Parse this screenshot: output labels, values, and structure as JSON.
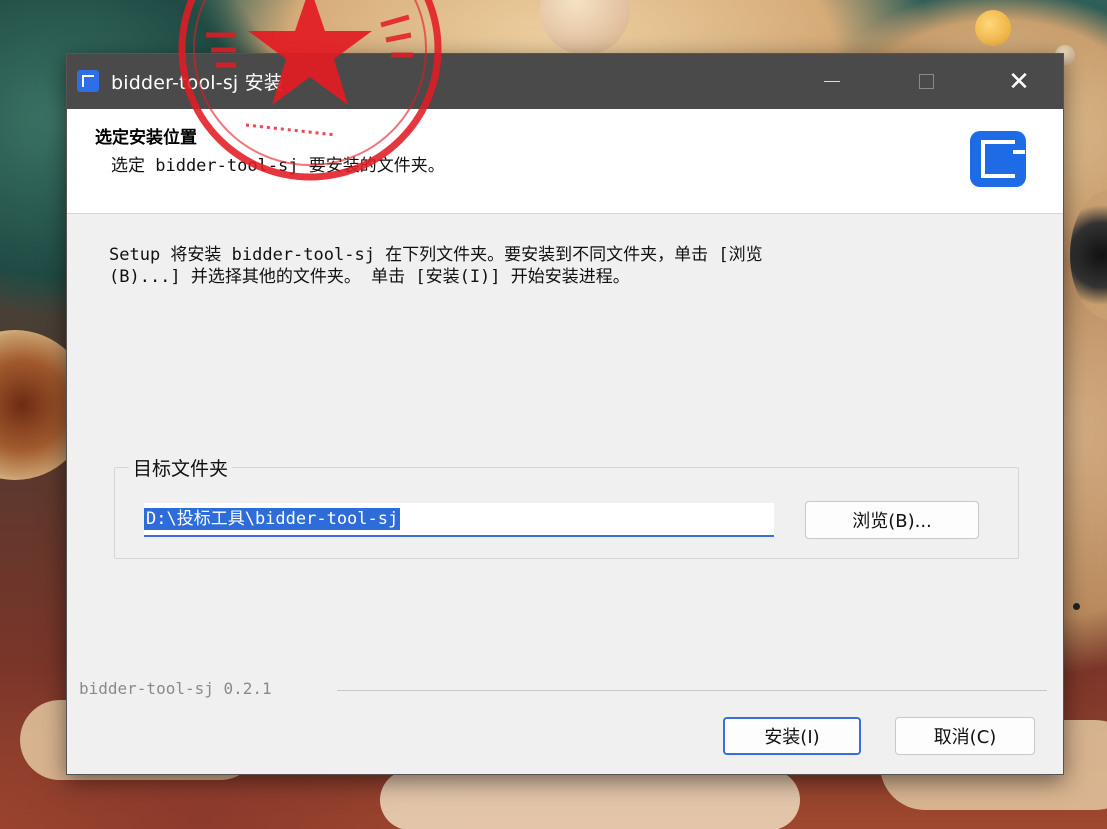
{
  "window": {
    "title": "bidder-tool-sj 安装",
    "controls": {
      "minimize": "—",
      "maximize": "□",
      "close": "✕"
    }
  },
  "header": {
    "title": "选定安装位置",
    "subtitle": "选定 bidder-tool-sj 要安装的文件夹。",
    "logo_icon": "bid-tool-logo-icon"
  },
  "body": {
    "description": "Setup 将安装 bidder-tool-sj 在下列文件夹。要安装到不同文件夹，单击 [浏览\n(B)...] 并选择其他的文件夹。 单击 [安装(I)] 开始安装进程。"
  },
  "destination": {
    "group_label": "目标文件夹",
    "path_value": "D:\\投标工具\\bidder-tool-sj",
    "browse_label": "浏览(B)..."
  },
  "footer": {
    "version_text": "bidder-tool-sj 0.2.1",
    "install_label": "安装(I)",
    "cancel_label": "取消(C)"
  },
  "colors": {
    "accent": "#2e6cd9",
    "titlebar": "#4a4a4a",
    "stamp_red": "#e31b23"
  }
}
